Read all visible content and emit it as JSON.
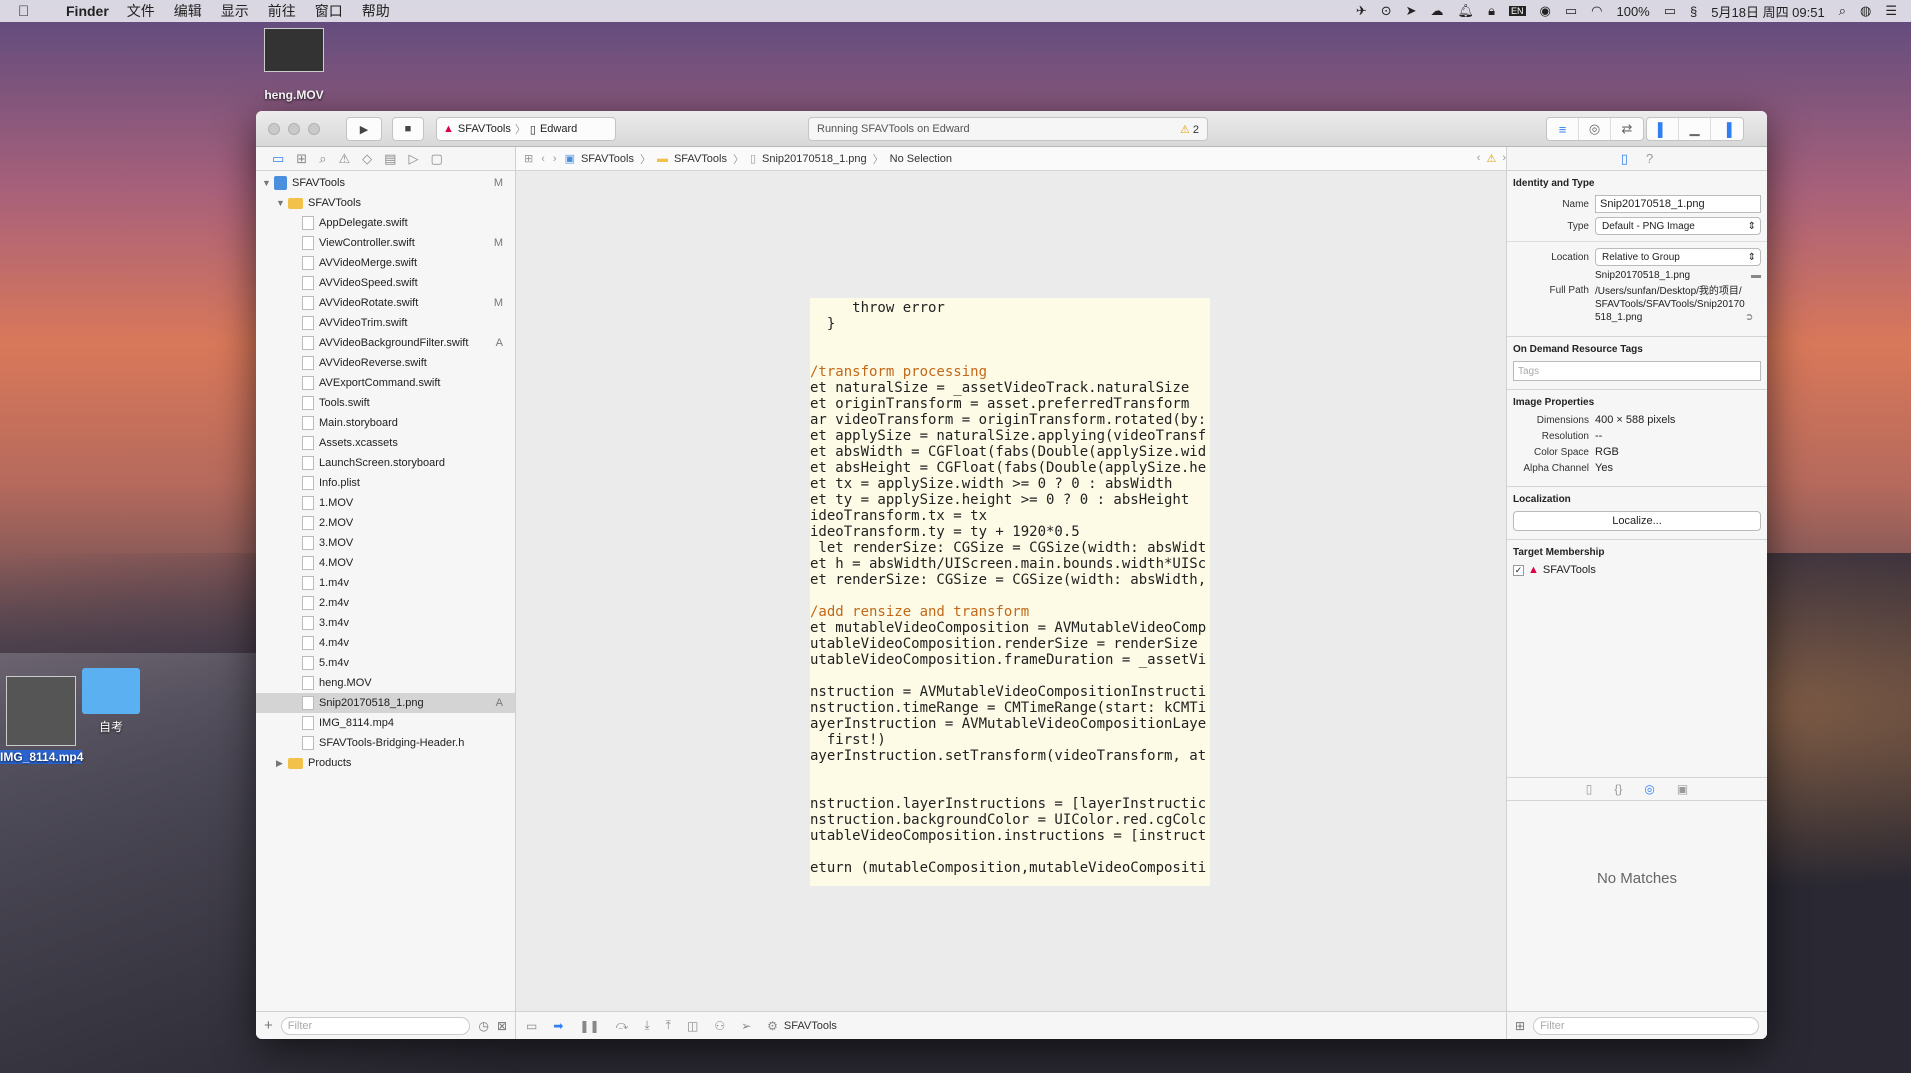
{
  "menubar": {
    "app": "Finder",
    "items": [
      "文件",
      "编辑",
      "显示",
      "前往",
      "窗口",
      "帮助"
    ],
    "input_method": "EN",
    "battery": "100%",
    "datetime": "5月18日 周四  09:51"
  },
  "desktop": {
    "top_file": "heng.MOV",
    "selected_file": "IMG_8114.mp4",
    "folder": "自考"
  },
  "toolbar": {
    "scheme": "SFAVTools",
    "device": "Edward",
    "status": "Running SFAVTools on Edward",
    "warnings": "2"
  },
  "jumpbar": {
    "items": [
      "SFAVTools",
      "SFAVTools",
      "Snip20170518_1.png",
      "No Selection"
    ]
  },
  "navigator": {
    "project": {
      "name": "SFAVTools",
      "status": "M"
    },
    "group": "SFAVTools",
    "files": [
      {
        "name": "AppDelegate.swift",
        "status": ""
      },
      {
        "name": "ViewController.swift",
        "status": "M"
      },
      {
        "name": "AVVideoMerge.swift",
        "status": ""
      },
      {
        "name": "AVVideoSpeed.swift",
        "status": ""
      },
      {
        "name": "AVVideoRotate.swift",
        "status": "M"
      },
      {
        "name": "AVVideoTrim.swift",
        "status": ""
      },
      {
        "name": "AVVideoBackgroundFilter.swift",
        "status": "A"
      },
      {
        "name": "AVVideoReverse.swift",
        "status": ""
      },
      {
        "name": "AVExportCommand.swift",
        "status": ""
      },
      {
        "name": "Tools.swift",
        "status": ""
      },
      {
        "name": "Main.storyboard",
        "status": ""
      },
      {
        "name": "Assets.xcassets",
        "status": ""
      },
      {
        "name": "LaunchScreen.storyboard",
        "status": ""
      },
      {
        "name": "Info.plist",
        "status": ""
      },
      {
        "name": "1.MOV",
        "status": ""
      },
      {
        "name": "2.MOV",
        "status": ""
      },
      {
        "name": "3.MOV",
        "status": ""
      },
      {
        "name": "4.MOV",
        "status": ""
      },
      {
        "name": "1.m4v",
        "status": ""
      },
      {
        "name": "2.m4v",
        "status": ""
      },
      {
        "name": "3.m4v",
        "status": ""
      },
      {
        "name": "4.m4v",
        "status": ""
      },
      {
        "name": "5.m4v",
        "status": ""
      },
      {
        "name": "heng.MOV",
        "status": ""
      },
      {
        "name": "Snip20170518_1.png",
        "status": "A"
      },
      {
        "name": "IMG_8114.mp4",
        "status": ""
      },
      {
        "name": "SFAVTools-Bridging-Header.h",
        "status": ""
      }
    ],
    "products": "Products",
    "filter_placeholder": "Filter"
  },
  "code_lines": [
    "     throw error",
    "  }",
    "",
    "",
    "/transform processing",
    "et naturalSize = _assetVideoTrack.naturalSize",
    "et originTransform = asset.preferredTransform",
    "ar videoTransform = originTransform.rotated(by:",
    "et applySize = naturalSize.applying(videoTransf",
    "et absWidth = CGFloat(fabs(Double(applySize.wid",
    "et absHeight = CGFloat(fabs(Double(applySize.he",
    "et tx = applySize.width >= 0 ? 0 : absWidth",
    "et ty = applySize.height >= 0 ? 0 : absHeight",
    "ideoTransform.tx = tx",
    "ideoTransform.ty = ty + 1920*0.5",
    " let renderSize: CGSize = CGSize(width: absWidt",
    "et h = absWidth/UIScreen.main.bounds.width*UISc",
    "et renderSize: CGSize = CGSize(width: absWidth,",
    "",
    "/add rensize and transform",
    "et mutableVideoComposition = AVMutableVideoComp",
    "utableVideoComposition.renderSize = renderSize",
    "utableVideoComposition.frameDuration = _assetVi",
    "",
    "nstruction = AVMutableVideoCompositionInstructi",
    "nstruction.timeRange = CMTimeRange(start: kCMTi",
    "ayerInstruction = AVMutableVideoCompositionLaye",
    "  first!)",
    "ayerInstruction.setTransform(videoTransform, at",
    "",
    "",
    "nstruction.layerInstructions = [layerInstructic",
    "nstruction.backgroundColor = UIColor.red.cgColc",
    "utableVideoComposition.instructions = [instruct",
    "",
    "eturn (mutableComposition,mutableVideoCompositi"
  ],
  "editor_footer": {
    "target": "SFAVTools"
  },
  "inspector": {
    "identity_title": "Identity and Type",
    "name_label": "Name",
    "name_value": "Snip20170518_1.png",
    "type_label": "Type",
    "type_value": "Default - PNG Image",
    "location_label": "Location",
    "location_value": "Relative to Group",
    "location_file": "Snip20170518_1.png",
    "fullpath_label": "Full Path",
    "fullpath_value": "/Users/sunfan/Desktop/我的项目/SFAVTools/SFAVTools/Snip20170518_1.png",
    "odr_title": "On Demand Resource Tags",
    "tags_placeholder": "Tags",
    "image_title": "Image Properties",
    "dimensions_label": "Dimensions",
    "dimensions_value": "400 × 588 pixels",
    "resolution_label": "Resolution",
    "resolution_value": "--",
    "colorspace_label": "Color Space",
    "colorspace_value": "RGB",
    "alpha_label": "Alpha Channel",
    "alpha_value": "Yes",
    "localization_title": "Localization",
    "localize_button": "Localize...",
    "target_title": "Target Membership",
    "target_name": "SFAVTools",
    "no_matches": "No Matches",
    "filter_placeholder": "Filter"
  }
}
